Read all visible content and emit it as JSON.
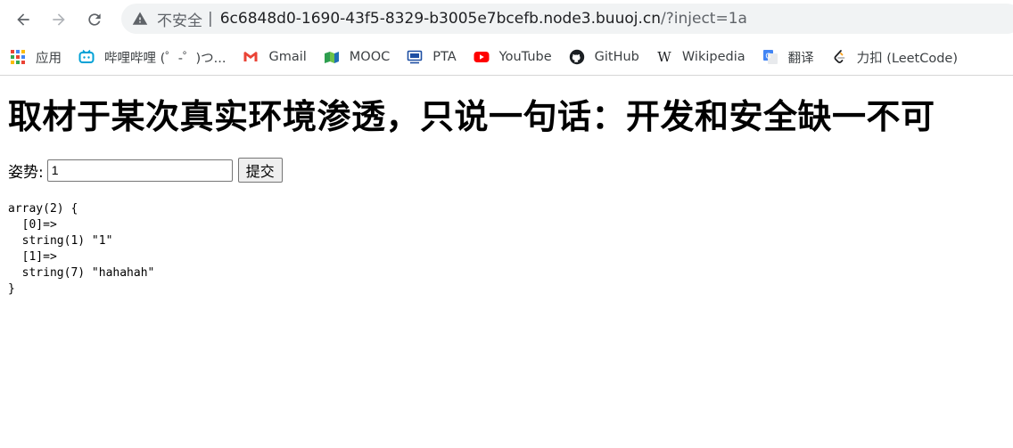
{
  "browser": {
    "url_insecure_label": "不安全",
    "url_separator": "|",
    "url_host": "6c6848d0-1690-43f5-8329-b3005e7bcefb.node3.buuoj.cn",
    "url_path": "/?inject=1a"
  },
  "bookmarks": [
    {
      "label": "应用",
      "icon": "apps-grid-icon"
    },
    {
      "label": "哔哩哔哩 (゜-゜)つ...",
      "icon": "bilibili-icon"
    },
    {
      "label": "Gmail",
      "icon": "gmail-icon"
    },
    {
      "label": "MOOC",
      "icon": "mooc-icon"
    },
    {
      "label": "PTA",
      "icon": "pta-icon"
    },
    {
      "label": "YouTube",
      "icon": "youtube-icon"
    },
    {
      "label": "GitHub",
      "icon": "github-icon"
    },
    {
      "label": "Wikipedia",
      "icon": "wikipedia-icon"
    },
    {
      "label": "翻译",
      "icon": "translate-icon"
    },
    {
      "label": "力扣 (LeetCode)",
      "icon": "leetcode-icon"
    }
  ],
  "page": {
    "heading": "取材于某次真实环境渗透，只说一句话：开发和安全缺一不可",
    "form_label": "姿势:",
    "input_value": "1",
    "submit_label": "提交",
    "dump_output": "array(2) {\n  [0]=>\n  string(1) \"1\"\n  [1]=>\n  string(7) \"hahahah\"\n}"
  },
  "colors": {
    "youtube": "#ff0000",
    "gmail": "#ea4335",
    "bilibili": "#00a1d6"
  }
}
